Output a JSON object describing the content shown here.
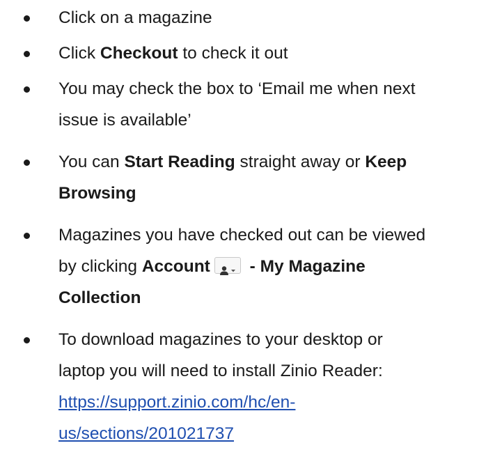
{
  "instructions": {
    "items": [
      {
        "text": "Click on a magazine"
      },
      {
        "pre": "Click ",
        "bold": "Checkout",
        "post": " to check it out"
      },
      {
        "line1": "You may check the box to ‘Email me when next",
        "line2": "issue is available’"
      },
      {
        "line1_pre": "You can ",
        "line1_bold1": "Start Reading",
        "line1_mid": " straight away or ",
        "line1_bold2": "Keep",
        "line2_bold": "Browsing"
      },
      {
        "line1": "Magazines you have checked out can be viewed",
        "line2_pre": "by clicking ",
        "line2_bold": "Account",
        "line2_bold2": " - My Magazine",
        "line3_bold": "Collection",
        "icon": "account-person-dropdown-icon"
      },
      {
        "line1": "To download magazines to your desktop or",
        "line2": "laptop you will need to install Zinio Reader:",
        "link_line1": "https://support.zinio.com/hc/en-",
        "link_line2": "us/sections/201021737"
      }
    ]
  },
  "colors": {
    "text": "#1a1a1a",
    "link": "#1f4fb0"
  }
}
